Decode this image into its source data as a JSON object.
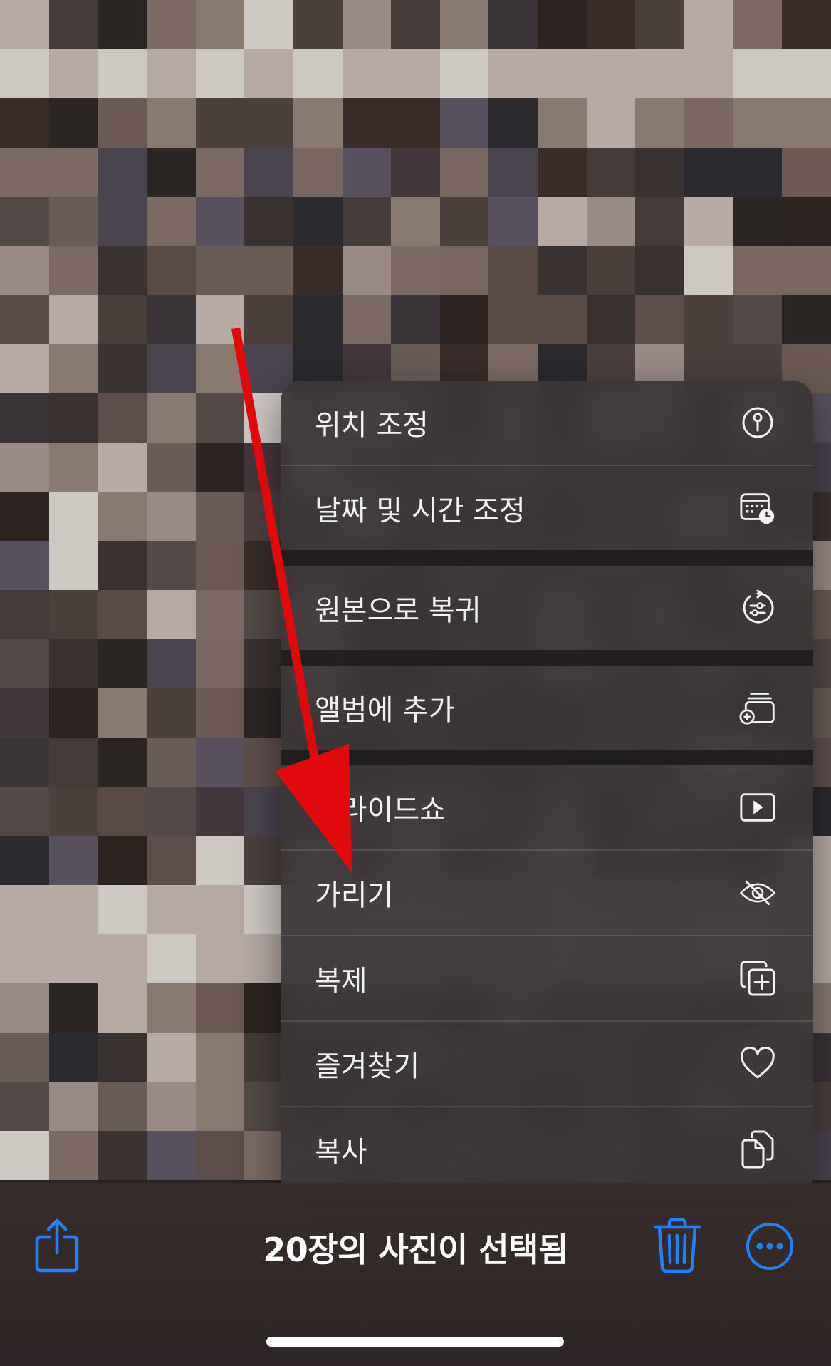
{
  "toolbar": {
    "selection_label": "20장의 사진이 선택됨",
    "share_icon": "share-icon",
    "trash_icon": "trash-icon",
    "more_icon": "ellipsis-circle-icon",
    "accent_color": "#1e82ff"
  },
  "menu": {
    "items": [
      {
        "label": "위치 조정",
        "icon": "location-pin-icon"
      },
      {
        "label": "날짜 및 시간 조정",
        "icon": "calendar-clock-icon"
      },
      {
        "label": "원본으로 복귀",
        "icon": "revert-icon"
      },
      {
        "label": "앨범에 추가",
        "icon": "add-to-album-icon"
      },
      {
        "label": "슬라이드쇼",
        "icon": "play-rectangle-icon"
      },
      {
        "label": "가리기",
        "icon": "eye-slash-icon"
      },
      {
        "label": "복제",
        "icon": "duplicate-icon"
      },
      {
        "label": "즐겨찾기",
        "icon": "heart-icon"
      },
      {
        "label": "복사",
        "icon": "copy-icon"
      }
    ]
  },
  "annotation": {
    "arrow_color": "#e00a0a"
  }
}
